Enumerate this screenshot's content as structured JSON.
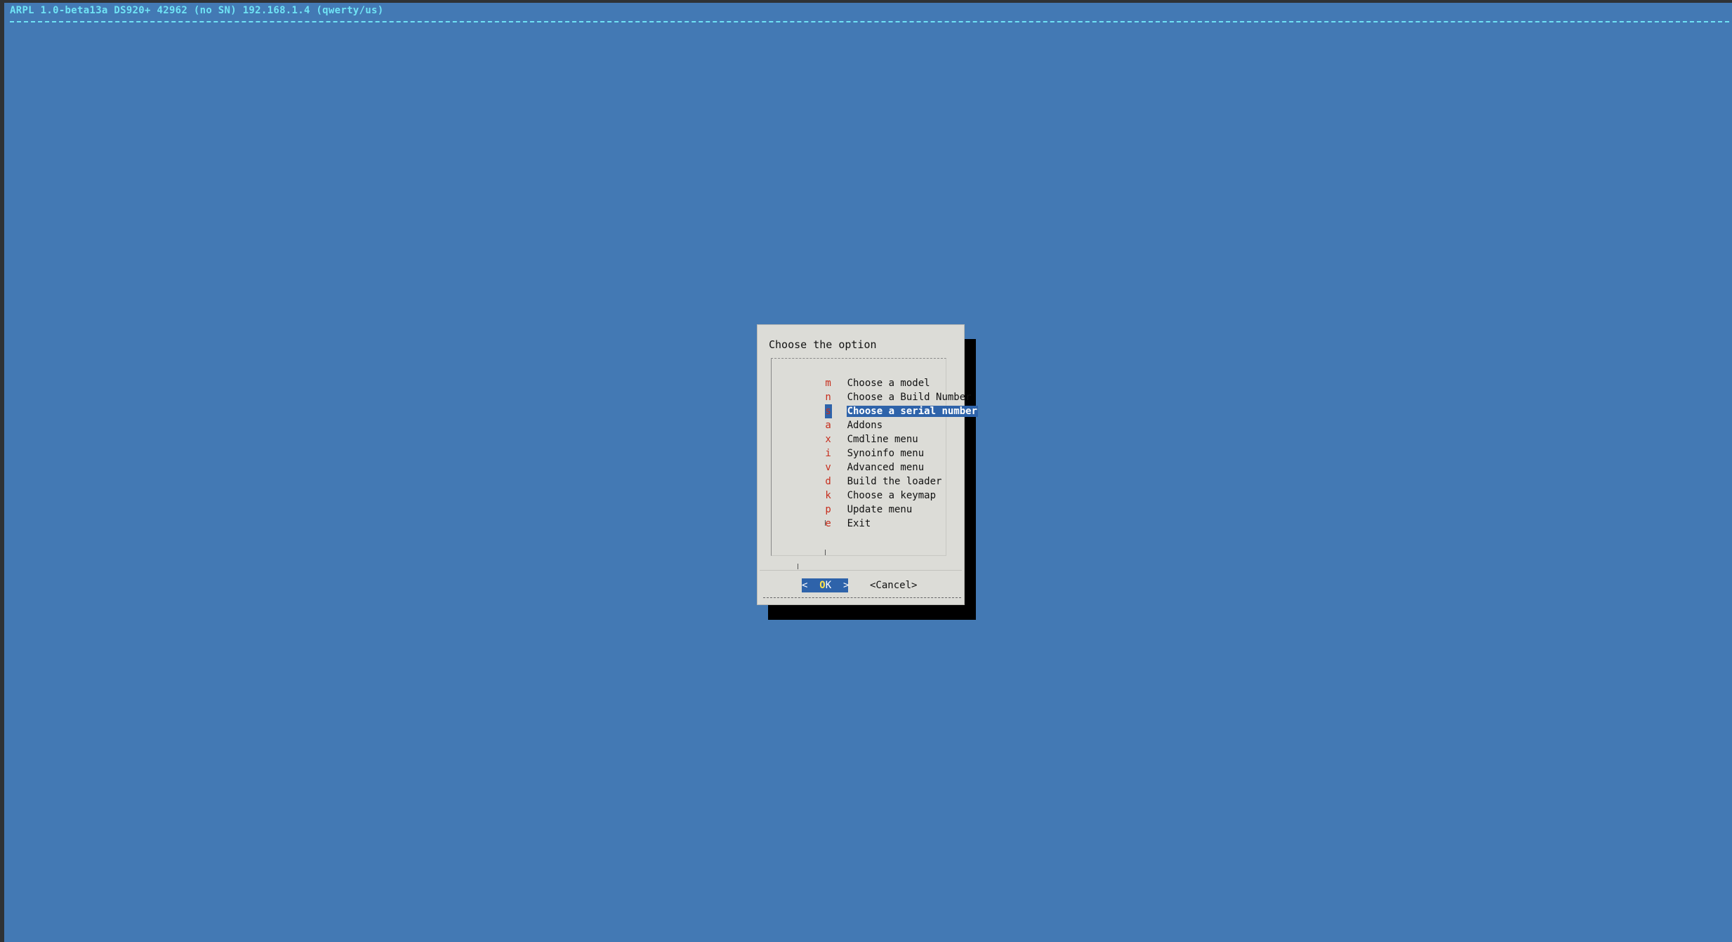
{
  "screen": {
    "backtitle": "ARPL 1.0-beta13a DS920+ 42962 (no SN) 192.168.1.4 (qwerty/us)"
  },
  "dialog": {
    "title": "Choose the option",
    "items": [
      {
        "key": "m",
        "label": "Choose a model"
      },
      {
        "key": "n",
        "label": "Choose a Build Number"
      },
      {
        "key": "s",
        "label": "Choose a serial number",
        "selected": true
      },
      {
        "key": "a",
        "label": "Addons"
      },
      {
        "key": "x",
        "label": "Cmdline menu"
      },
      {
        "key": "i",
        "label": "Synoinfo menu"
      },
      {
        "key": "v",
        "label": "Advanced menu"
      },
      {
        "key": "d",
        "label": "Build the loader"
      },
      {
        "key": "k",
        "label": "Choose a keymap"
      },
      {
        "key": "p",
        "label": "Update menu"
      },
      {
        "key": "e",
        "label": "Exit"
      }
    ],
    "ok_left": "<  ",
    "ok_hotkey": "O",
    "ok_rest": "K  >",
    "cancel_label": "<Cancel>"
  },
  "colors": {
    "background": "#4379b4",
    "backtitle": "#6fe3f5",
    "hotkey": "#c62d1c",
    "selection": "#2e63aa"
  }
}
